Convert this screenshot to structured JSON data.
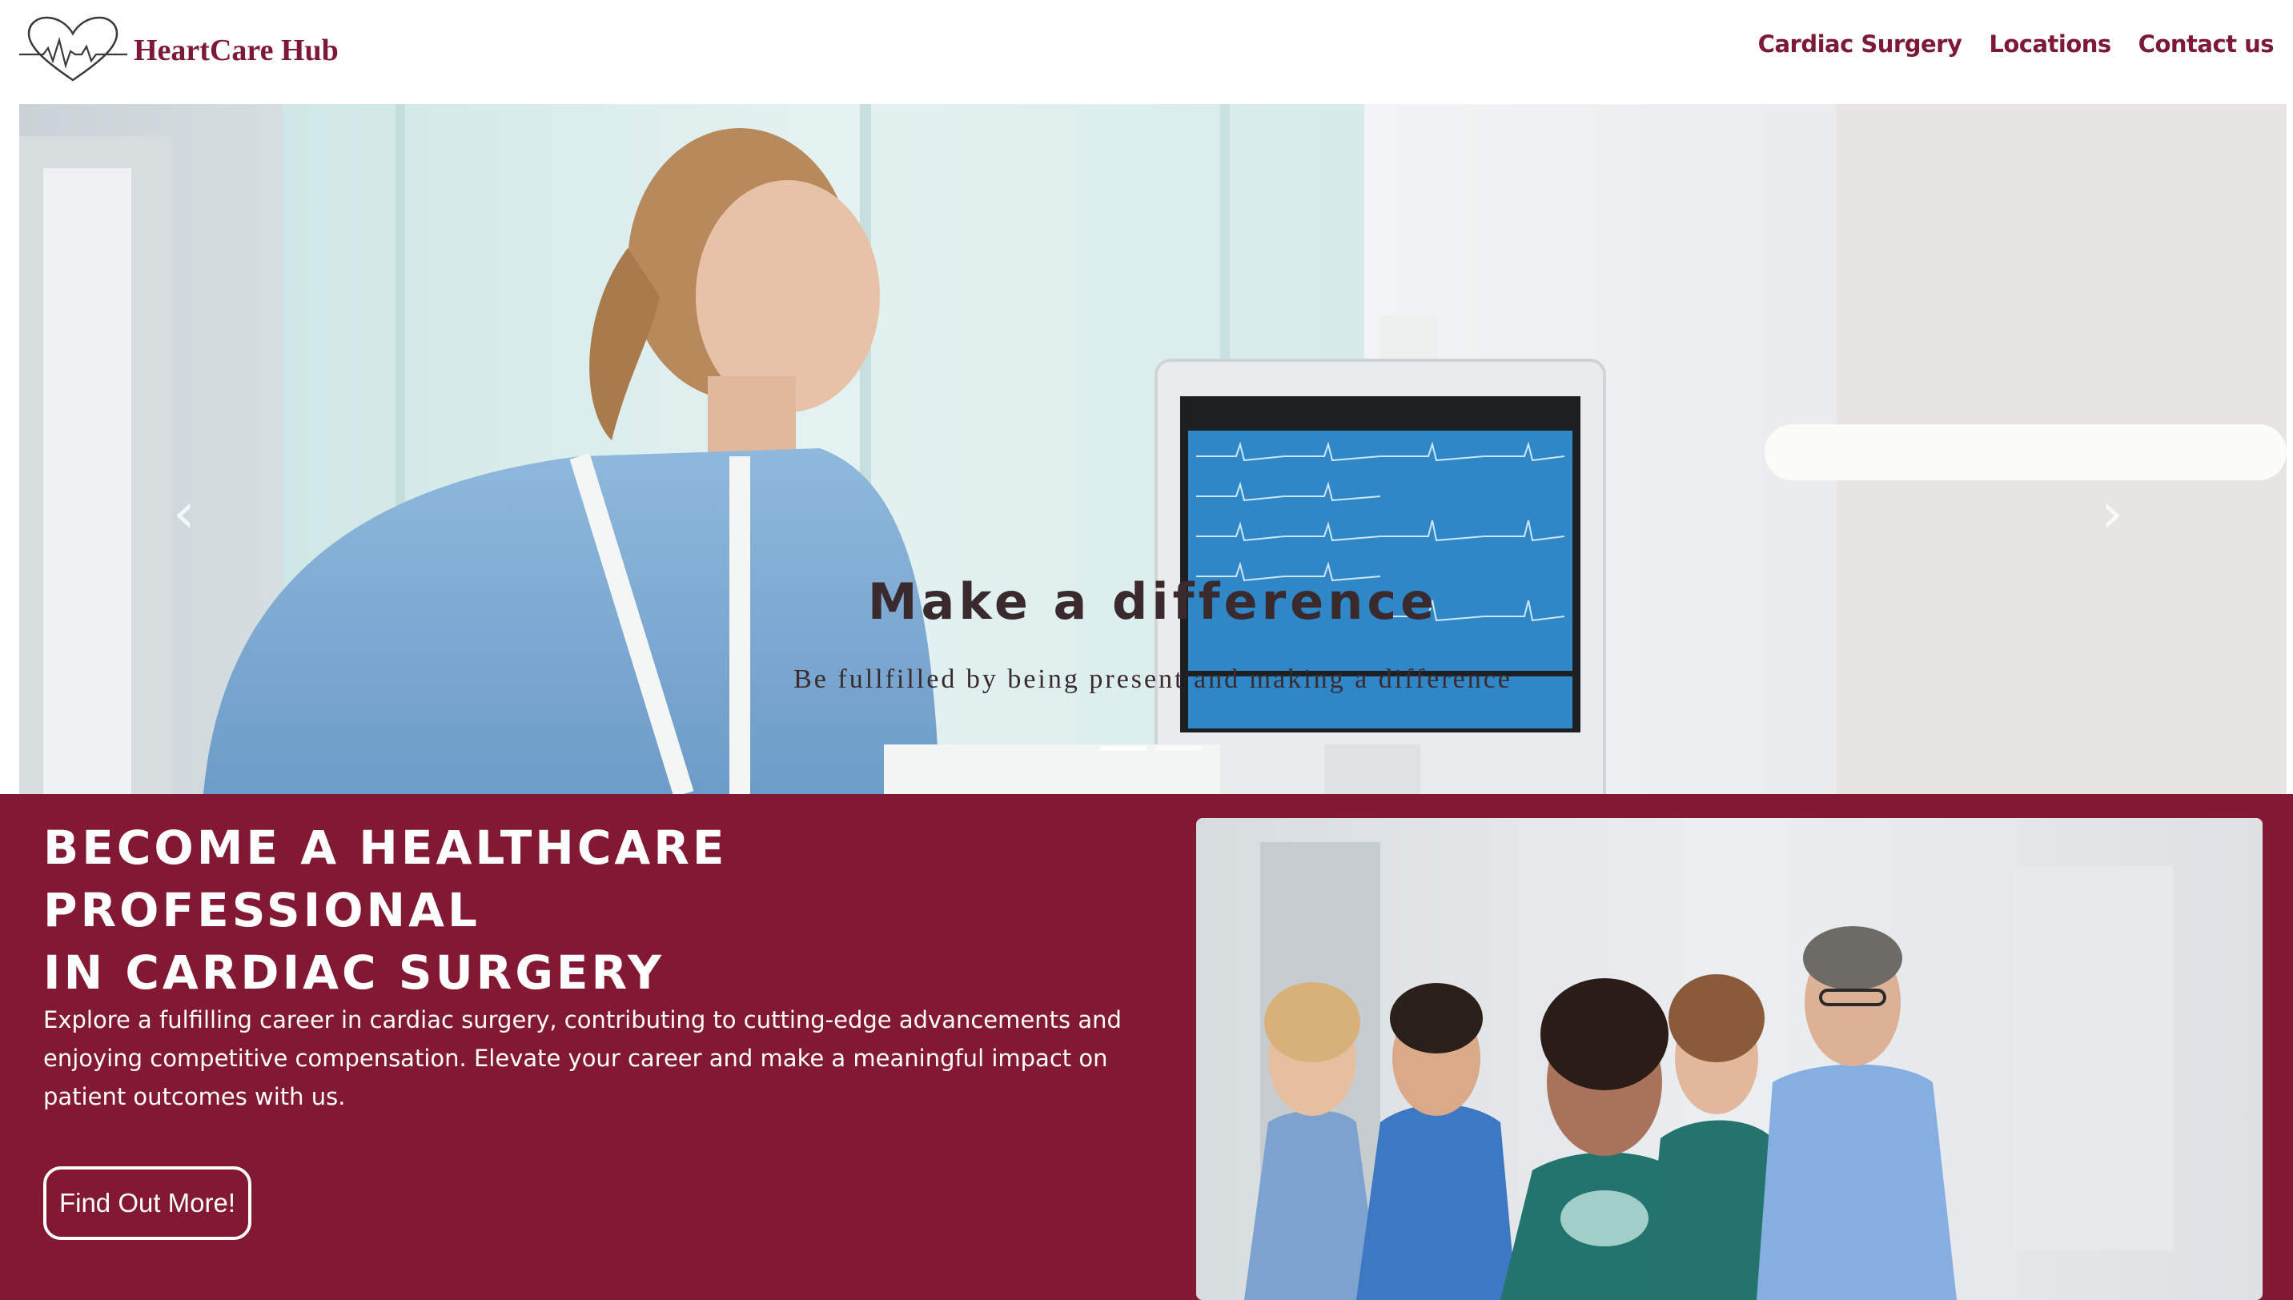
{
  "brand": {
    "name": "HeartCare Hub",
    "logo_icon": "heart-ecg-icon",
    "color": "#7d1935"
  },
  "nav": {
    "items": [
      {
        "label": "Cardiac Surgery"
      },
      {
        "label": "Locations"
      },
      {
        "label": "Contact us"
      }
    ]
  },
  "hero": {
    "title": "Make a difference",
    "subtitle": "Be fullfilled by being present and making a difference",
    "prev_icon": "chevron-left-icon",
    "next_icon": "chevron-right-icon",
    "slides_count": 2,
    "active_slide": 1
  },
  "promo": {
    "title_line1": "BECOME A HEALTHCARE PROFESSIONAL",
    "title_line2": "IN CARDIAC SURGERY",
    "body": "Explore a fulfilling career in cardiac surgery, contributing to cutting-edge advancements and enjoying competitive compensation. Elevate your career and make a meaningful impact on patient outcomes with us.",
    "button_label": "Find Out More!",
    "background_color": "#821832"
  }
}
